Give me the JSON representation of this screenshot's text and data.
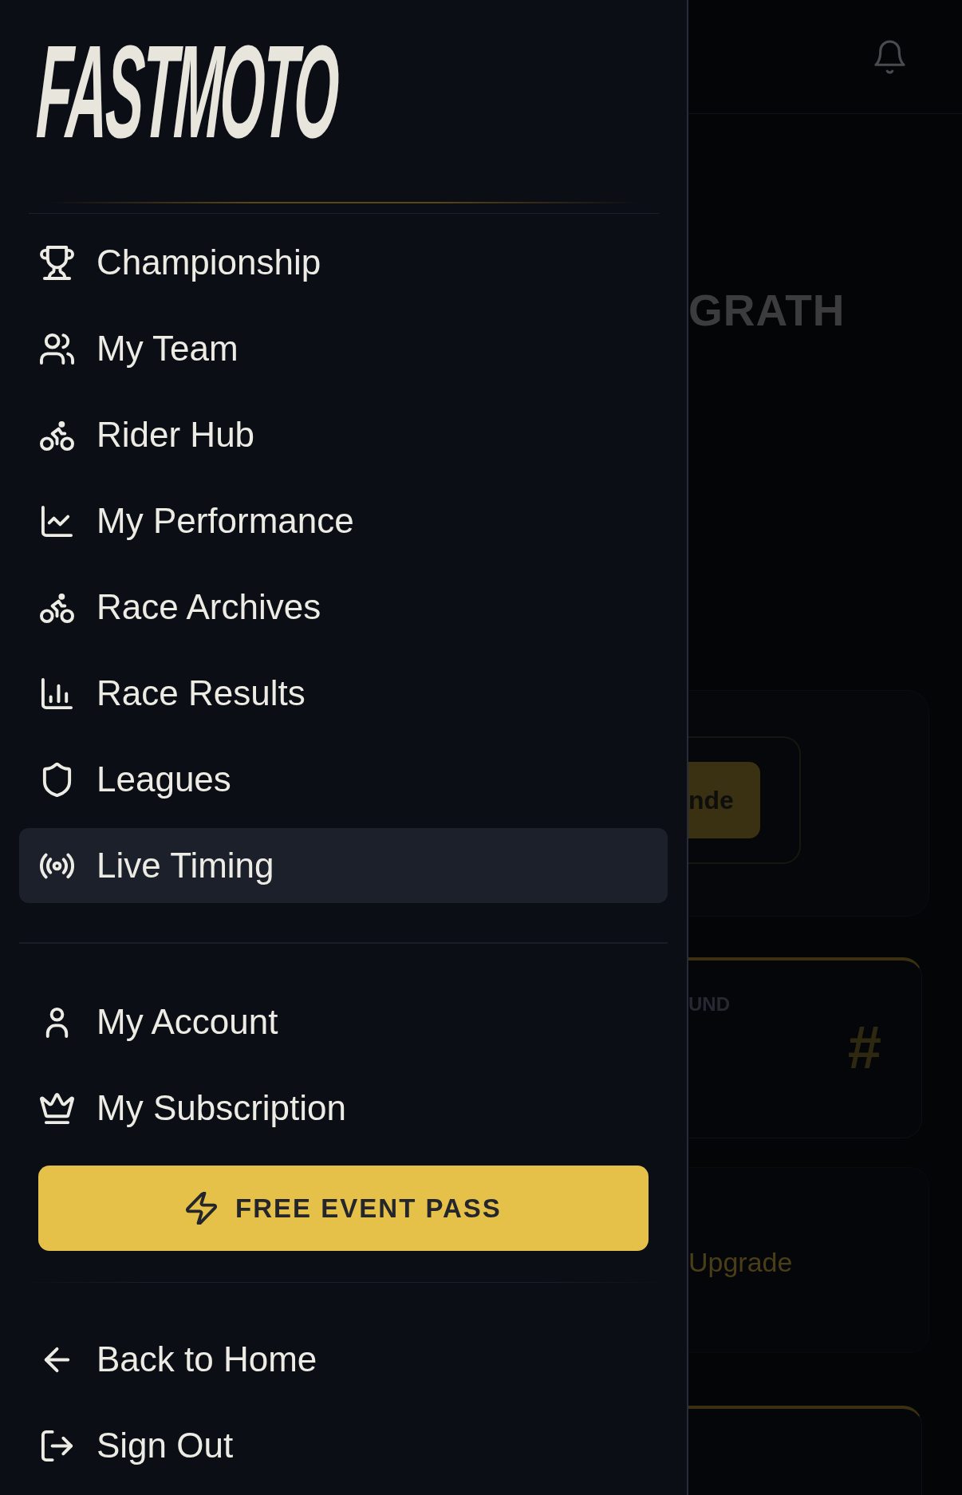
{
  "drawer": {
    "logo": "FASTMOTO",
    "main_menu": [
      {
        "label": "Championship",
        "selected": false
      },
      {
        "label": "My Team",
        "selected": false
      },
      {
        "label": "Rider Hub",
        "selected": false
      },
      {
        "label": "My Performance",
        "selected": false
      },
      {
        "label": "Race Archives",
        "selected": false
      },
      {
        "label": "Race Results",
        "selected": false
      },
      {
        "label": "Leagues",
        "selected": false
      },
      {
        "label": "Live Timing",
        "selected": true
      }
    ],
    "account_menu": [
      {
        "label": "My Account",
        "selected": false
      },
      {
        "label": "My Subscription",
        "selected": false
      }
    ],
    "cta_button": {
      "label": "FREE EVENT PASS"
    },
    "footer_menu": [
      {
        "label": "Back to Home",
        "selected": false
      },
      {
        "label": "Sign Out",
        "selected": false
      }
    ]
  },
  "background_page": {
    "title": "GRATH",
    "action_button": "nde",
    "stat_label": "UND",
    "stat_symbol": "#",
    "upgrade_link": "Upgrade"
  }
}
